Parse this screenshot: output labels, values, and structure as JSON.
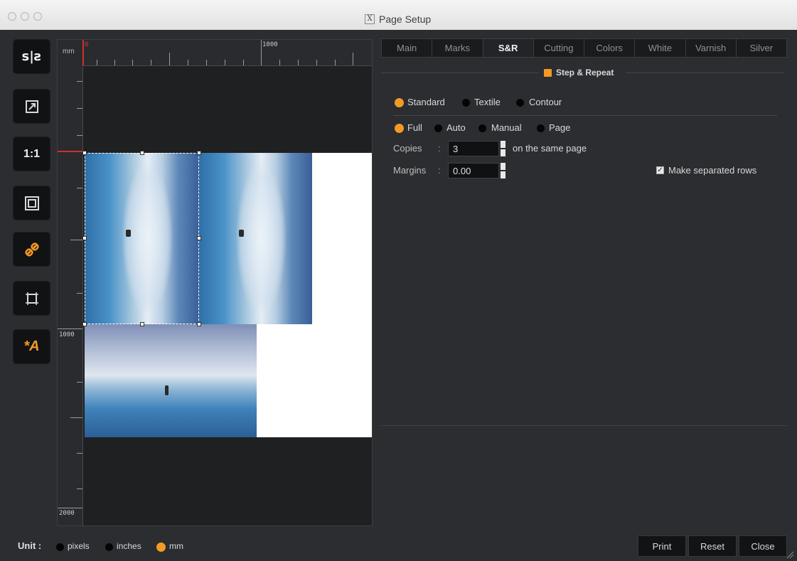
{
  "window": {
    "title": "Page Setup"
  },
  "ruler": {
    "unit": "mm",
    "h_labels": [
      "0",
      "1000"
    ],
    "v_labels": [
      "1000",
      "2000"
    ]
  },
  "tabs": [
    {
      "label": "Main",
      "active": false
    },
    {
      "label": "Marks",
      "active": false
    },
    {
      "label": "S&R",
      "active": true
    },
    {
      "label": "Cutting",
      "active": false
    },
    {
      "label": "Colors",
      "active": false
    },
    {
      "label": "White",
      "active": false
    },
    {
      "label": "Varnish",
      "active": false
    },
    {
      "label": "Silver",
      "active": false
    }
  ],
  "sr": {
    "step_repeat_label": "Step & Repeat",
    "step_repeat_checked": true,
    "mode_options": [
      "Standard",
      "Textile",
      "Contour"
    ],
    "mode_selected": "Standard",
    "fill_options": [
      "Full",
      "Auto",
      "Manual",
      "Page"
    ],
    "fill_selected": "Full",
    "copies_label": "Copies",
    "copies_value": "3",
    "copies_suffix": "on the same page",
    "margins_label": "Margins",
    "margins_value": "0.00",
    "separated_rows_label": "Make separated rows",
    "separated_rows_checked": true
  },
  "unit_selector": {
    "label": "Unit :",
    "options": [
      "pixels",
      "inches",
      "mm"
    ],
    "selected": "mm"
  },
  "buttons": {
    "print": "Print",
    "reset": "Reset",
    "close": "Close"
  },
  "colors": {
    "accent": "#f39a25",
    "background": "#2b2d30",
    "tab_active": "#f2f2f2"
  }
}
